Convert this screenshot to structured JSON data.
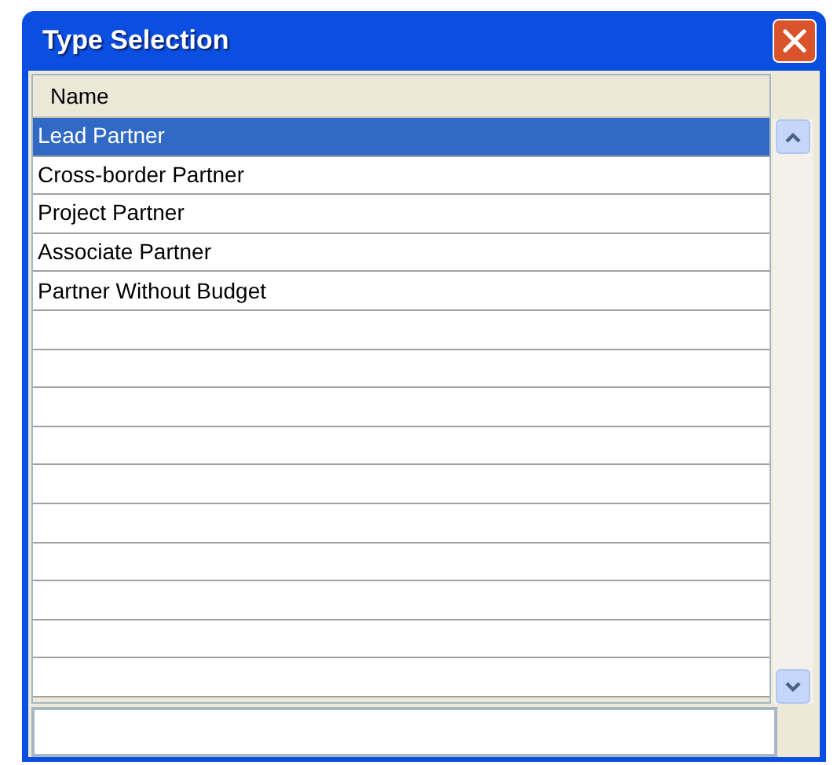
{
  "window": {
    "title": "Type Selection"
  },
  "table": {
    "columns": [
      "Name"
    ],
    "rows": [
      {
        "name": "Lead Partner",
        "selected": true
      },
      {
        "name": "Cross-border Partner",
        "selected": false
      },
      {
        "name": "Project Partner",
        "selected": false
      },
      {
        "name": "Associate Partner",
        "selected": false
      },
      {
        "name": "Partner Without Budget",
        "selected": false
      }
    ]
  }
}
